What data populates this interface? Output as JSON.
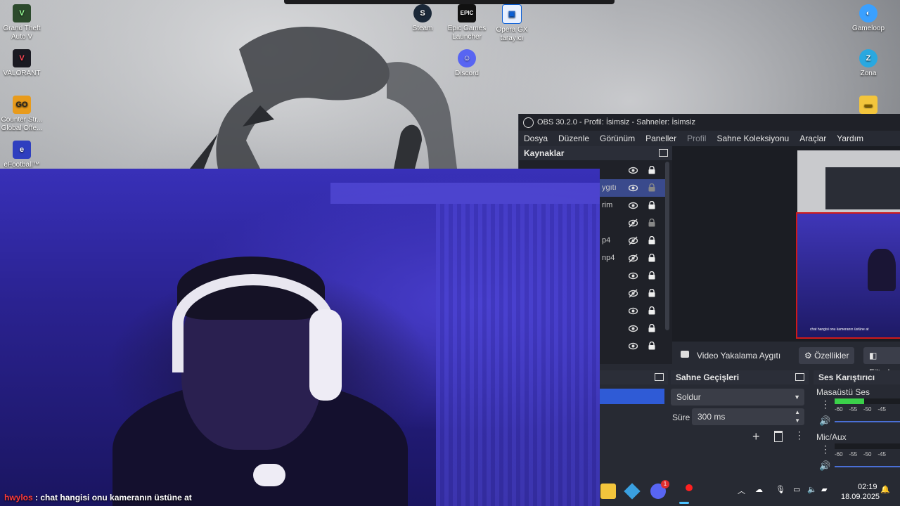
{
  "desktop": {
    "icons": [
      {
        "id": "gta",
        "label": "Grand Theft Auto V"
      },
      {
        "id": "valorant",
        "label": "VALORANT"
      },
      {
        "id": "csgo",
        "label": "Counter Str... Global Offe..."
      },
      {
        "id": "efootball",
        "label": "eFootball™"
      },
      {
        "id": "steam",
        "label": "Steam"
      },
      {
        "id": "epic",
        "label": "Epic Games Launcher"
      },
      {
        "id": "opera",
        "label": "Opera GX tarayıcı"
      },
      {
        "id": "discord",
        "label": "Discord"
      },
      {
        "id": "gameloop",
        "label": "Gameloop"
      },
      {
        "id": "zona",
        "label": "Zona"
      }
    ]
  },
  "obs": {
    "title": "OBS 30.2.0 - Profil: İsimsiz - Sahneler: İsimsiz",
    "menu": [
      "Dosya",
      "Düzenle",
      "Görünüm",
      "Paneller",
      "Profil",
      "Sahne Koleksiyonu",
      "Araçlar",
      "Yardım"
    ],
    "sources_title": "Kaynaklar",
    "sources": [
      {
        "label": "",
        "visible": true,
        "locked": true
      },
      {
        "label": "ygıtı",
        "visible": true,
        "locked": false,
        "selected": true
      },
      {
        "label": "rim",
        "visible": true,
        "locked": true
      },
      {
        "label": "",
        "visible": false,
        "locked": false
      },
      {
        "label": "p4",
        "visible": false,
        "locked": true
      },
      {
        "label": "np4",
        "visible": false,
        "locked": true
      },
      {
        "label": "",
        "visible": true,
        "locked": true
      },
      {
        "label": "",
        "visible": false,
        "locked": true
      },
      {
        "label": "",
        "visible": true,
        "locked": true
      },
      {
        "label": "",
        "visible": true,
        "locked": true
      },
      {
        "label": "",
        "visible": true,
        "locked": true
      }
    ],
    "preview_toolbar": {
      "source_name": "Video Yakalama Aygıtı",
      "properties": "Özellikler",
      "filters": "Filtrel"
    },
    "preview_chat_text": "chat hangisi onu kameranın üstüne at",
    "transitions": {
      "title": "Sahne Geçişleri",
      "selected": "Soldur",
      "duration_label": "Süre",
      "duration_value": "300 ms"
    },
    "mixer": {
      "title": "Ses Karıştırıcı",
      "channels": [
        {
          "name": "Masaüstü Ses",
          "level": 0.45
        },
        {
          "name": "Mic/Aux",
          "level": 0.0
        }
      ],
      "ticks": [
        "-60",
        "-55",
        "-50",
        "-45"
      ]
    }
  },
  "chat": {
    "user": "hwylos",
    "separator": ":",
    "message": "chat hangisi onu kameranın üstüne at"
  },
  "taskbar": {
    "discord_badge": "1",
    "time": "02:19",
    "date": "18.09.2025"
  }
}
